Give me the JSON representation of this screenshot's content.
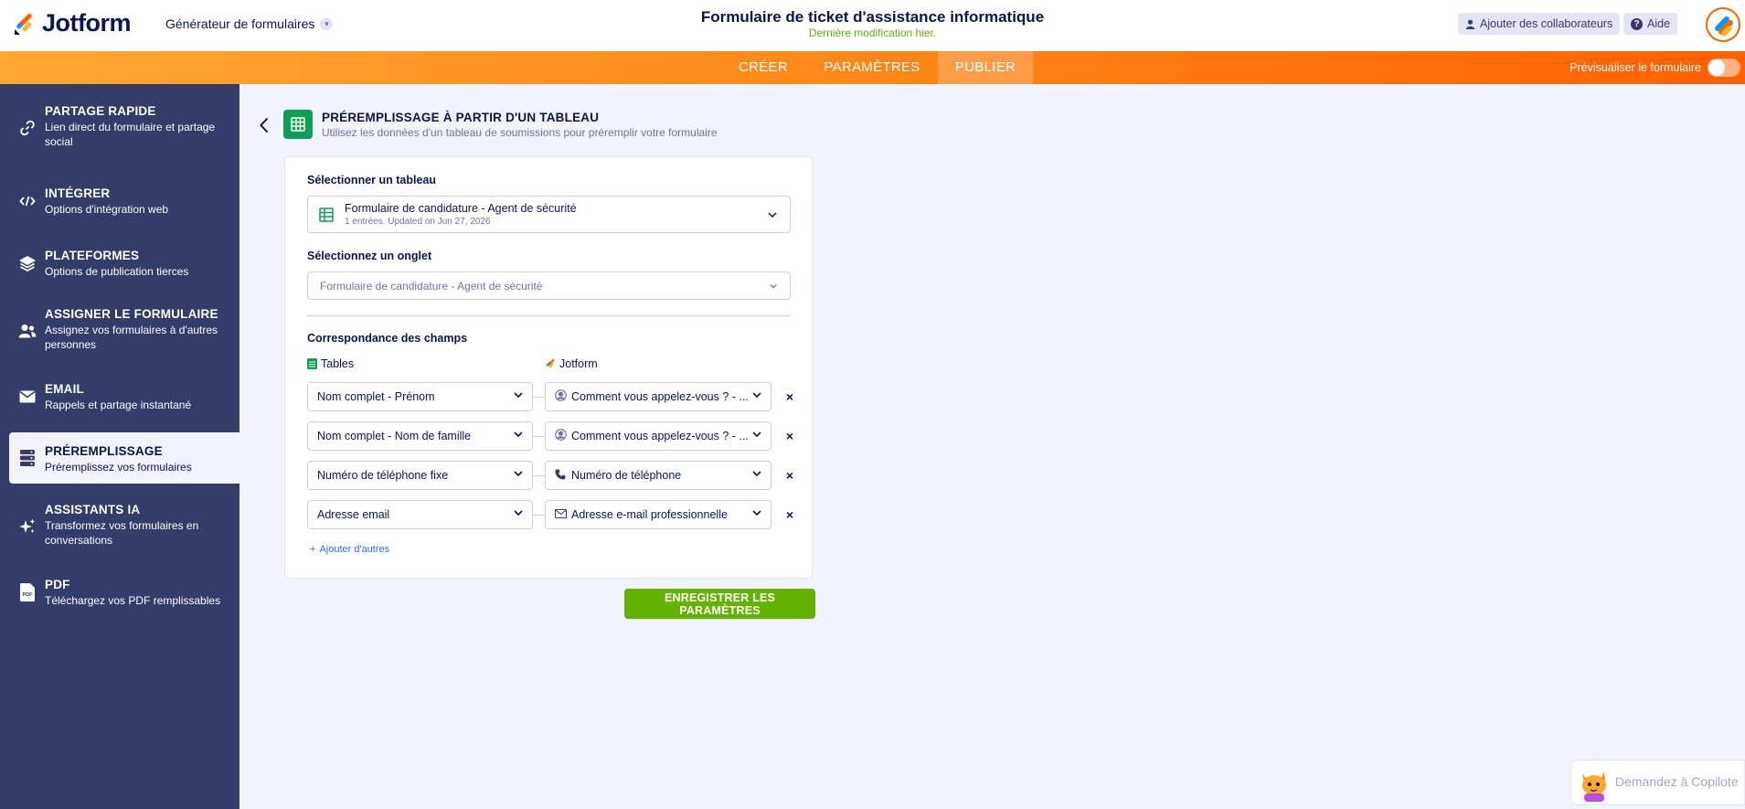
{
  "header": {
    "brand": "Jotform",
    "builder_menu": "Générateur de formulaires",
    "form_title": "Formulaire de ticket d'assistance informatique",
    "last_modified": "Dernière modification hier.",
    "add_collaborators": "Ajouter des collaborateurs",
    "help": "Aide"
  },
  "nav": {
    "tabs": [
      {
        "label": "CRÉER"
      },
      {
        "label": "PARAMÈTRES"
      },
      {
        "label": "PUBLIER",
        "active": true
      }
    ],
    "preview_label": "Prévisualiser le formulaire"
  },
  "sidebar": {
    "items": [
      {
        "title": "PARTAGE RAPIDE",
        "subtitle": "Lien direct du formulaire et partage social",
        "icon": "link-icon"
      },
      {
        "title": "INTÉGRER",
        "subtitle": "Options d'intégration web",
        "icon": "code-icon"
      },
      {
        "title": "PLATEFORMES",
        "subtitle": "Options de publication tierces",
        "icon": "layers-icon"
      },
      {
        "title": "ASSIGNER LE FORMULAIRE",
        "subtitle": "Assignez vos formulaires à d'autres personnes",
        "icon": "users-icon"
      },
      {
        "title": "EMAIL",
        "subtitle": "Rappels et partage instantané",
        "icon": "envelope-icon"
      },
      {
        "title": "PRÉREMPLISSAGE",
        "subtitle": "Préremplissez vos formulaires",
        "icon": "database-icon",
        "active": true
      },
      {
        "title": "ASSISTANTS IA",
        "subtitle": "Transformez vos formulaires en conversations",
        "icon": "sparkle-icon"
      },
      {
        "title": "PDF",
        "subtitle": "Téléchargez vos PDF remplissables",
        "icon": "pdf-icon"
      }
    ]
  },
  "page": {
    "title": "PRÉREMPLISSAGE À PARTIR D'UN TABLEAU",
    "subtitle": "Utilisez les données d'un tableau de soumissions pour préremplir votre formulaire"
  },
  "card": {
    "select_table_label": "Sélectionner un tableau",
    "table_name": "Formulaire de candidature - Agent de sécurité",
    "table_meta": "1 entrées. Updated on Jun 27, 2026",
    "select_tab_label": "Sélectionnez un onglet",
    "tab_value": "Formulaire de candidature - Agent de sécurité",
    "mapping_label": "Correspondance des champs",
    "col_tables": "Tables",
    "col_jotform": "Jotform",
    "mappings": [
      {
        "source": "Nom complet - Prénom",
        "target": "Comment vous appelez-vous ? - ...",
        "target_icon": "user-circle-icon"
      },
      {
        "source": "Nom complet - Nom de famille",
        "target": "Comment vous appelez-vous ? - ...",
        "target_icon": "user-circle-icon"
      },
      {
        "source": "Numéro de téléphone fixe",
        "target": "Numéro de téléphone",
        "target_icon": "phone-icon"
      },
      {
        "source": "Adresse email",
        "target": "Adresse e-mail professionnelle",
        "target_icon": "envelope-icon"
      }
    ],
    "add_more": "Ajouter d'autres",
    "remove_glyph": "×",
    "add_glyph": "+"
  },
  "save_button": "ENREGISTRER LES PARAMÈTRES",
  "copilot": "Demandez à Copilote",
  "colors": {
    "sidebar": "#343c6a",
    "accent_orange": "#ff6100",
    "save_green": "#64b200",
    "sheet_green": "#0f9d58",
    "link_blue": "#2e69ff"
  }
}
